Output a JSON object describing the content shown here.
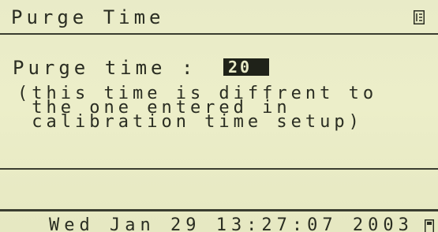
{
  "screen": {
    "title": "Purge Time",
    "menu_icon": "menu-list-icon",
    "field": {
      "label": "Purge time :",
      "value": "20"
    },
    "note_lines": [
      "(this time is diffrent to",
      " the one entered in",
      " calibration time setup)"
    ],
    "status_bar": {
      "datetime": "Wed Jan 29 13:27:07 2003",
      "icon": "status-indicator-icon"
    }
  }
}
